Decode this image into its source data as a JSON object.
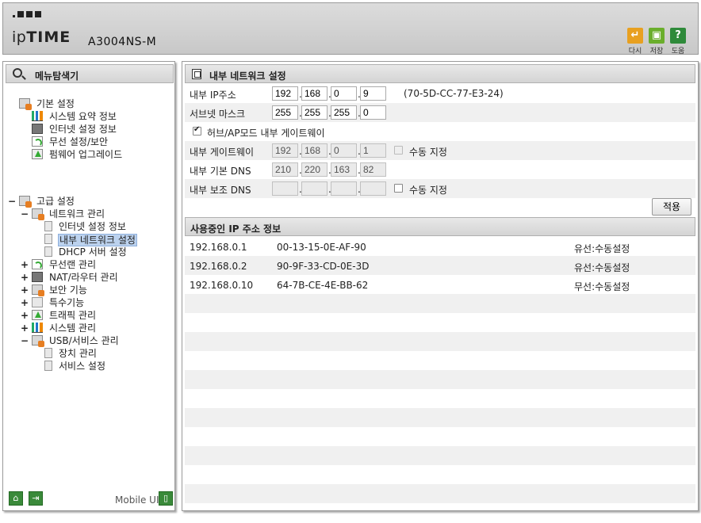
{
  "header": {
    "brand_prefix": "ip",
    "brand_bold": "TIME",
    "model": "A3004NS-M",
    "buttons": [
      {
        "label": "다시",
        "icon": "refresh-icon",
        "color": "#e8a020"
      },
      {
        "label": "저장",
        "icon": "save-icon",
        "color": "#6aae2c"
      },
      {
        "label": "도움",
        "icon": "help-icon",
        "color": "#2e8a3a"
      }
    ]
  },
  "menu": {
    "title": "메뉴탐색기",
    "basic": {
      "label": "기본 설정",
      "items": [
        "시스템 요약 정보",
        "인터넷 설정 정보",
        "무선 설정/보안",
        "펌웨어 업그레이드"
      ]
    },
    "advanced": {
      "expander": "−",
      "label": "고급 설정",
      "network": {
        "expander": "−",
        "label": "네트워크 관리",
        "items": [
          "인터넷 설정 정보",
          "내부 네트워크 설정",
          "DHCP 서버 설정"
        ]
      },
      "groups": [
        {
          "expander": "+",
          "label": "무선랜 관리"
        },
        {
          "expander": "+",
          "label": "NAT/라우터 관리"
        },
        {
          "expander": "+",
          "label": "보안 기능"
        },
        {
          "expander": "+",
          "label": "특수기능"
        },
        {
          "expander": "+",
          "label": "트래픽 관리"
        },
        {
          "expander": "+",
          "label": "시스템 관리"
        }
      ],
      "usb": {
        "expander": "−",
        "label": "USB/서비스 관리",
        "items": [
          "장치 관리",
          "서비스 설정"
        ]
      }
    },
    "footer": {
      "mobile_label": "Mobile UI"
    }
  },
  "internal_network": {
    "title": "내부 네트워크 설정",
    "ip_label": "내부 IP주소",
    "ip": [
      "192",
      "168",
      "0",
      "9"
    ],
    "mac": "(70-5D-CC-77-E3-24)",
    "subnet_label": "서브넷 마스크",
    "subnet": [
      "255",
      "255",
      "255",
      "0"
    ],
    "hub_ap_label": "허브/AP모드 내부 게이트웨이",
    "hub_ap_checked": true,
    "gateway_label": "내부 게이트웨이",
    "gateway": [
      "192",
      "168",
      "0",
      "1"
    ],
    "gateway_manual_label": "수동 지정",
    "dns1_label": "내부 기본 DNS",
    "dns1": [
      "210",
      "220",
      "163",
      "82"
    ],
    "dns2_label": "내부 보조 DNS",
    "dns2": [
      "",
      "",
      "",
      ""
    ],
    "dns2_manual_label": "수동 지정",
    "apply_label": "적용"
  },
  "ip_info": {
    "title": "사용중인 IP 주소 정보",
    "rows": [
      {
        "ip": "192.168.0.1",
        "mac": "00-13-15-0E-AF-90",
        "type": "유선:수동설정"
      },
      {
        "ip": "192.168.0.2",
        "mac": "90-9F-33-CD-0E-3D",
        "type": "유선:수동설정"
      },
      {
        "ip": "192.168.0.10",
        "mac": "64-7B-CE-4E-BB-62",
        "type": "무선:수동설정"
      }
    ]
  }
}
